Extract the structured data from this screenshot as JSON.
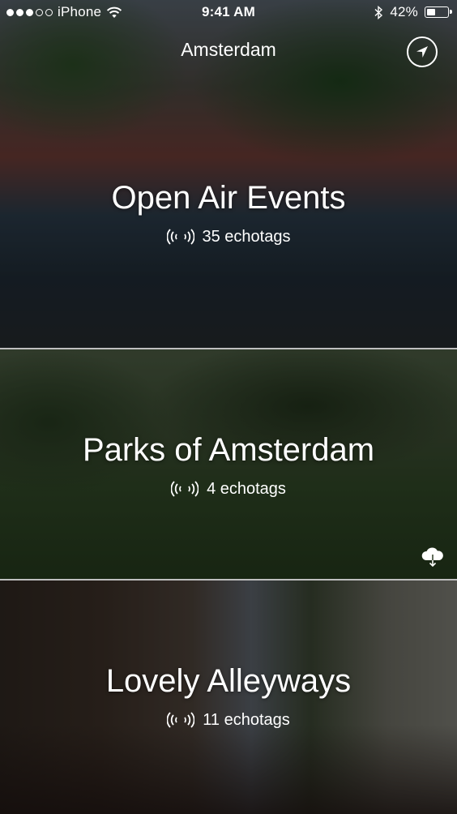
{
  "status_bar": {
    "carrier": "iPhone",
    "time": "9:41 AM",
    "battery_percent_label": "42%",
    "battery_level": 0.42,
    "signal_bars_filled": 3,
    "signal_bars_total": 5
  },
  "nav": {
    "title": "Amsterdam",
    "locate_icon": "location-arrow-icon"
  },
  "cards": [
    {
      "title": "Open Air Events",
      "count_label": "35 echotags",
      "icon": "echotag-signal-icon"
    },
    {
      "title": "Parks of Amsterdam",
      "count_label": "4 echotags",
      "icon": "echotag-signal-icon",
      "action_icon": "cloud-download-icon"
    },
    {
      "title": "Lovely Alleyways",
      "count_label": "11 echotags",
      "icon": "echotag-signal-icon"
    }
  ],
  "colors": {
    "text": "#ffffff",
    "divider": "#bfbfbf",
    "overlay": "#000000"
  }
}
